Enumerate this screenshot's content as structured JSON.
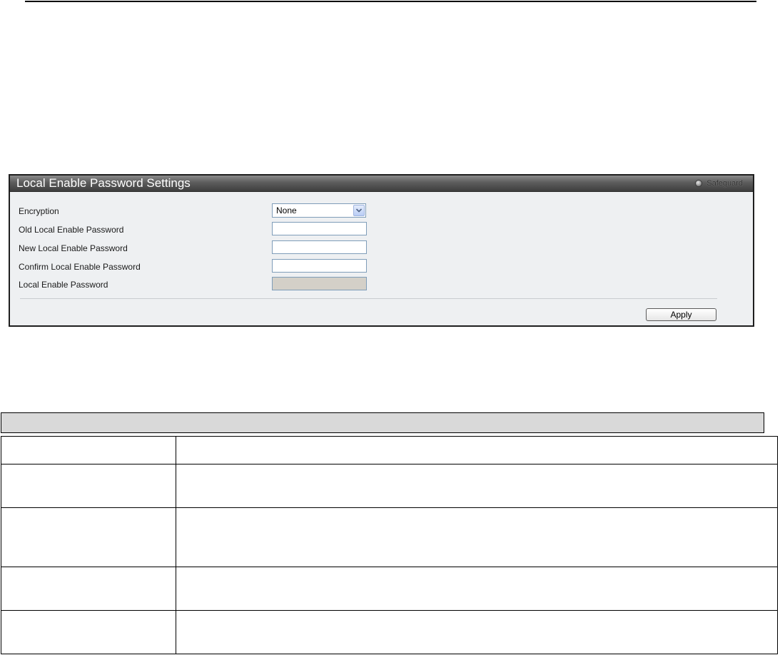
{
  "panel": {
    "title": "Local Enable Password Settings",
    "safeguard_label": "Safeguard",
    "fields": [
      {
        "label": "Encryption",
        "type": "select",
        "value": "None"
      },
      {
        "label": "Old Local Enable Password",
        "type": "password",
        "value": ""
      },
      {
        "label": "New Local Enable Password",
        "type": "password",
        "value": ""
      },
      {
        "label": "Confirm Local Enable Password",
        "type": "password",
        "value": ""
      },
      {
        "label": "Local Enable Password",
        "type": "readonly",
        "value": ""
      }
    ],
    "apply_label": "Apply",
    "colors": {
      "header_dark": "#3e3e3e",
      "panel_bg": "#eef0f2",
      "field_border": "#7f9db9",
      "disabled_field": "#d4d0c8"
    },
    "icons": {
      "safeguard": "safeguard-indicator-icon",
      "dropdown": "chevron-down-icon"
    }
  },
  "doc_table": {
    "rows": [
      {
        "param": "",
        "description": ""
      },
      {
        "param": "",
        "description": ""
      },
      {
        "param": "",
        "description": ""
      },
      {
        "param": "",
        "description": ""
      },
      {
        "param": "",
        "description": ""
      }
    ]
  }
}
